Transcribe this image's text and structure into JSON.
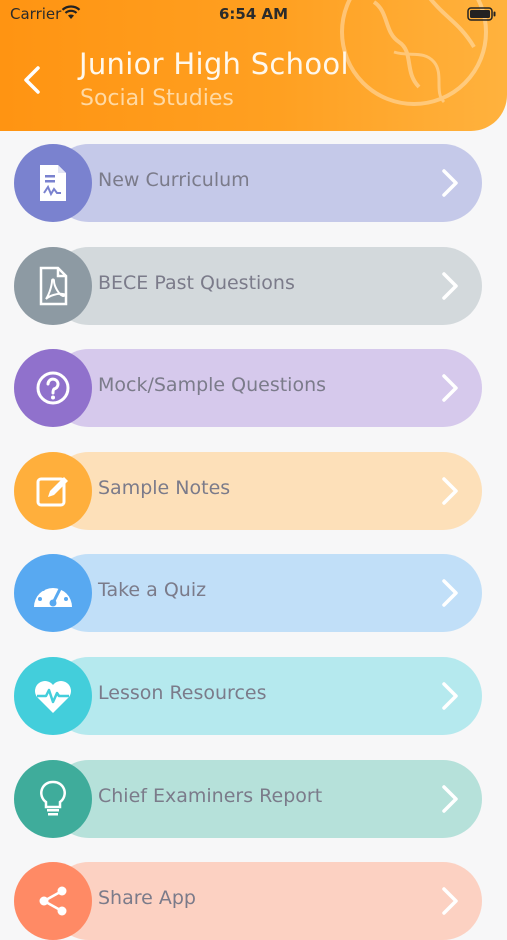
{
  "status_bar": {
    "carrier": "Carrier",
    "time": "6:54 AM"
  },
  "header": {
    "title": "Junior High School",
    "subtitle": "Social Studies"
  },
  "menu": [
    {
      "label": "New Curriculum",
      "icon": "document-icon",
      "circle_color": "#7a82cf",
      "pill_color": "#c5c9e9"
    },
    {
      "label": "BECE Past Questions",
      "icon": "pdf-icon",
      "circle_color": "#8d9aa3",
      "pill_color": "#d3d9dc"
    },
    {
      "label": "Mock/Sample Questions",
      "icon": "question-icon",
      "circle_color": "#9071cc",
      "pill_color": "#d6c9ec"
    },
    {
      "label": "Sample Notes",
      "icon": "edit-icon",
      "circle_color": "#ffaf3c",
      "pill_color": "#fde0b9"
    },
    {
      "label": "Take a Quiz",
      "icon": "gauge-icon",
      "circle_color": "#58a9f1",
      "pill_color": "#c1dff8"
    },
    {
      "label": "Lesson Resources",
      "icon": "heartbeat-icon",
      "circle_color": "#43cedb",
      "pill_color": "#b5e9ee"
    },
    {
      "label": "Chief Examiners Report",
      "icon": "lightbulb-icon",
      "circle_color": "#3fac9b",
      "pill_color": "#b6e1da"
    },
    {
      "label": "Share App",
      "icon": "share-icon",
      "circle_color": "#ff8a65",
      "pill_color": "#fcd1c2"
    }
  ]
}
